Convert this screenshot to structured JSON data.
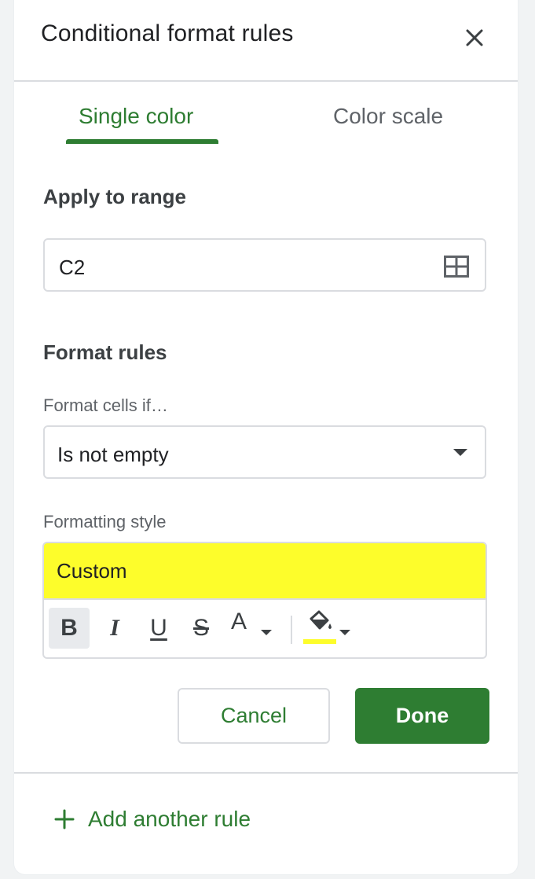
{
  "dialog": {
    "title": "Conditional format rules"
  },
  "tabs": [
    {
      "label": "Single color",
      "active": true
    },
    {
      "label": "Color scale",
      "active": false
    }
  ],
  "apply_range": {
    "heading": "Apply to range",
    "value": "C2"
  },
  "format_rules": {
    "heading": "Format rules",
    "condition_label": "Format cells if…",
    "condition_value": "Is not empty",
    "style_label": "Formatting style",
    "style_preview_text": "Custom",
    "style_fill_color": "#fdfd2b"
  },
  "toolbar": {
    "bold": "B",
    "italic": "I",
    "underline": "U",
    "strikethrough": "S",
    "text_color": "A",
    "fill_color_swatch": "#fdfd2b"
  },
  "actions": {
    "cancel_label": "Cancel",
    "done_label": "Done"
  },
  "footer": {
    "add_rule_label": "Add another rule"
  },
  "colors": {
    "accent": "#2e7d32",
    "text": "#202124",
    "muted": "#5f6368",
    "border": "#dadce0"
  }
}
